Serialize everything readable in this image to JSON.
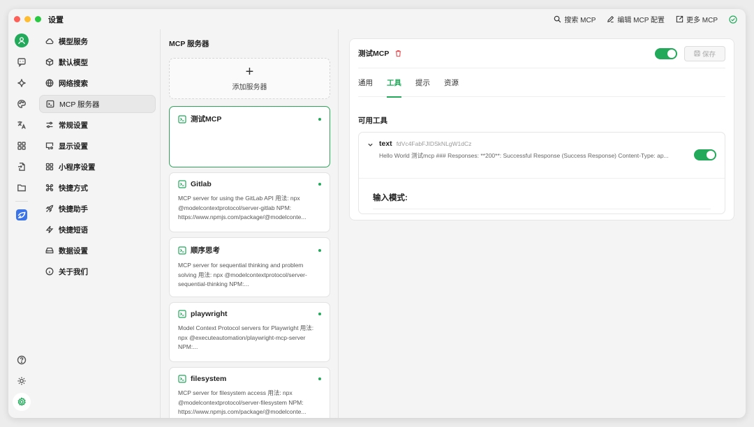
{
  "window": {
    "title": "设置"
  },
  "title_actions": [
    {
      "label": "搜索 MCP",
      "icon": "search-icon"
    },
    {
      "label": "编辑 MCP 配置",
      "icon": "pencil-icon"
    },
    {
      "label": "更多 MCP",
      "icon": "external-link-icon"
    }
  ],
  "nav": [
    {
      "label": "模型服务",
      "icon": "cloud-icon"
    },
    {
      "label": "默认模型",
      "icon": "cube-icon"
    },
    {
      "label": "网络搜索",
      "icon": "globe-icon"
    },
    {
      "label": "MCP 服务器",
      "icon": "terminal-icon",
      "active": true
    },
    {
      "label": "常规设置",
      "icon": "sliders-icon"
    },
    {
      "label": "显示设置",
      "icon": "monitor-icon"
    },
    {
      "label": "小程序设置",
      "icon": "grid-icon"
    },
    {
      "label": "快捷方式",
      "icon": "command-icon"
    },
    {
      "label": "快捷助手",
      "icon": "rocket-icon"
    },
    {
      "label": "快捷短语",
      "icon": "zap-icon"
    },
    {
      "label": "数据设置",
      "icon": "hard-drive-icon"
    },
    {
      "label": "关于我们",
      "icon": "info-icon"
    }
  ],
  "servers": {
    "title": "MCP 服务器",
    "add_label": "添加服务器",
    "add_symbol": "+",
    "items": [
      {
        "name": "测试MCP",
        "desc": ""
      },
      {
        "name": "Gitlab",
        "desc": "MCP server for using the GitLab API 用法: npx @modelcontextprotocol/server-gitlab NPM: https://www.npmjs.com/package/@modelconte..."
      },
      {
        "name": "顺序思考",
        "desc": "MCP server for sequential thinking and problem solving 用法: npx @modelcontextprotocol/server-sequential-thinking NPM:..."
      },
      {
        "name": "playwright",
        "desc": "Model Context Protocol servers for Playwright 用法: npx @executeautomation/playwright-mcp-server NPM:..."
      },
      {
        "name": "filesystem",
        "desc": "MCP server for filesystem access 用法: npx @modelcontextprotocol/server-filesystem NPM: https://www.npmjs.com/package/@modelconte..."
      }
    ]
  },
  "detail": {
    "title": "测试MCP",
    "save_label": "保存",
    "tabs": [
      "通用",
      "工具",
      "提示",
      "资源"
    ],
    "active_tab": "工具",
    "tools_label": "可用工具",
    "tool": {
      "name": "text",
      "id": "fdVc4FabFJIDSkNLgW1dCz",
      "desc": "Hello World 测试mcp ### Responses: **200**: Successful Response (Success Response) Content-Type: ap..."
    },
    "schema_label": "输入模式:"
  },
  "colors": {
    "accent": "#22a95a",
    "danger": "#e5484d",
    "brand_blue": "#3a74e8"
  }
}
